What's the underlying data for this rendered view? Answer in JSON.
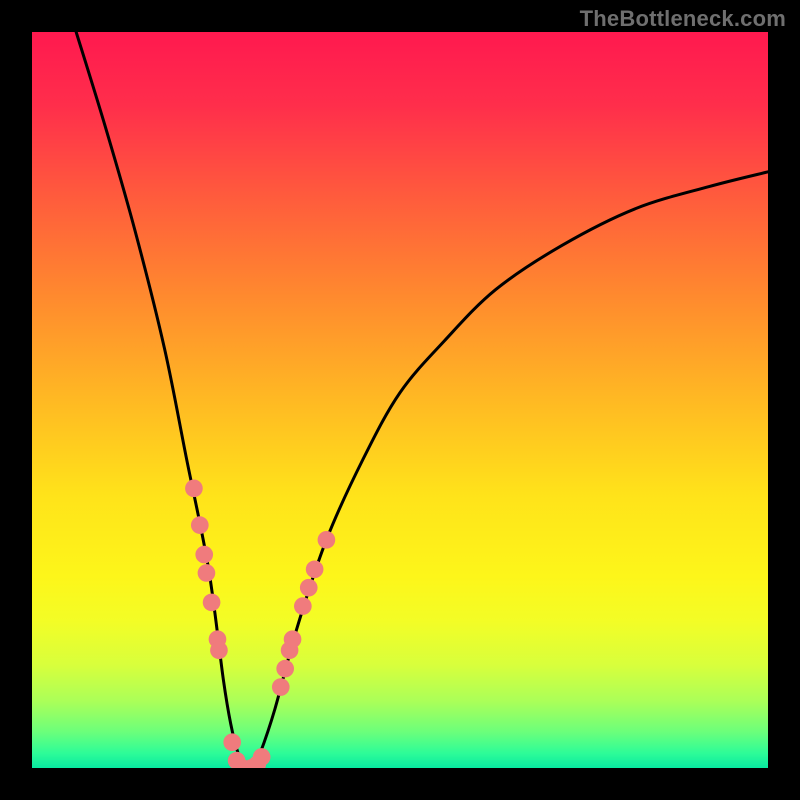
{
  "watermark": "TheBottleneck.com",
  "chart_data": {
    "type": "line",
    "title": "",
    "xlabel": "",
    "ylabel": "",
    "xlim": [
      0,
      100
    ],
    "ylim": [
      0,
      100
    ],
    "grid": false,
    "legend": false,
    "series": [
      {
        "name": "bottleneck-curve",
        "x": [
          6,
          10,
          14,
          18,
          21,
          24,
          26,
          27,
          28,
          29,
          30,
          31,
          33,
          36,
          40,
          45,
          50,
          56,
          63,
          72,
          82,
          92,
          100
        ],
        "y": [
          100,
          87,
          73,
          57,
          42,
          27,
          12,
          6,
          2,
          0,
          0,
          2,
          8,
          19,
          31,
          42,
          51,
          58,
          65,
          71,
          76,
          79,
          81
        ]
      }
    ],
    "dots": {
      "name": "highlight-dots",
      "color": "#f07b7d",
      "radius_pct": 1.2,
      "points": [
        {
          "x": 22.0,
          "y": 38.0
        },
        {
          "x": 22.8,
          "y": 33.0
        },
        {
          "x": 23.4,
          "y": 29.0
        },
        {
          "x": 23.7,
          "y": 26.5
        },
        {
          "x": 24.4,
          "y": 22.5
        },
        {
          "x": 25.2,
          "y": 17.5
        },
        {
          "x": 25.4,
          "y": 16.0
        },
        {
          "x": 27.2,
          "y": 3.5
        },
        {
          "x": 27.8,
          "y": 1.0
        },
        {
          "x": 28.6,
          "y": 0.0
        },
        {
          "x": 29.8,
          "y": 0.0
        },
        {
          "x": 30.6,
          "y": 0.5
        },
        {
          "x": 31.2,
          "y": 1.5
        },
        {
          "x": 33.8,
          "y": 11.0
        },
        {
          "x": 34.4,
          "y": 13.5
        },
        {
          "x": 35.0,
          "y": 16.0
        },
        {
          "x": 35.4,
          "y": 17.5
        },
        {
          "x": 36.8,
          "y": 22.0
        },
        {
          "x": 37.6,
          "y": 24.5
        },
        {
          "x": 38.4,
          "y": 27.0
        },
        {
          "x": 40.0,
          "y": 31.0
        }
      ]
    }
  }
}
